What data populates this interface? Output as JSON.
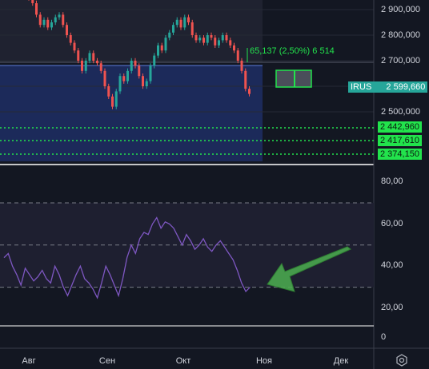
{
  "instrument": {
    "ticker": "IRUS",
    "last_price": "2 599,660"
  },
  "measure": {
    "label": "65,137 (2,50%) 6 514"
  },
  "price_axis": {
    "labels": [
      "2 900,000",
      "2 800,000",
      "2 700,000",
      "2 500,000"
    ],
    "levels": [
      "2 442,960",
      "2 417,610",
      "2 374,150"
    ]
  },
  "rsi_axis": {
    "labels": [
      "80,00",
      "60,00",
      "40,00",
      "20,00",
      "0"
    ]
  },
  "time_axis": {
    "labels": [
      "Авг",
      "Сен",
      "Окт",
      "Ноя",
      "Дек"
    ]
  },
  "colors": {
    "background": "#131722",
    "up": "#26a69a",
    "down": "#ef5350",
    "rsi_line": "#7e57c2",
    "level": "#22e34c",
    "arrow": "#4caf50",
    "box_fill": "#1c2a5a"
  },
  "icons": {
    "settings": "gear-icon",
    "arrow": "arrow-icon"
  },
  "chart_data": {
    "type": "line",
    "price_candles_approx": [
      {
        "o": 2955,
        "c": 2945
      },
      {
        "o": 2945,
        "c": 2925
      },
      {
        "o": 2925,
        "c": 2880
      },
      {
        "o": 2880,
        "c": 2840
      },
      {
        "o": 2840,
        "c": 2860
      },
      {
        "o": 2860,
        "c": 2830
      },
      {
        "o": 2830,
        "c": 2850
      },
      {
        "o": 2850,
        "c": 2870
      },
      {
        "o": 2870,
        "c": 2880
      },
      {
        "o": 2880,
        "c": 2840
      },
      {
        "o": 2840,
        "c": 2800
      },
      {
        "o": 2800,
        "c": 2770
      },
      {
        "o": 2770,
        "c": 2740
      },
      {
        "o": 2740,
        "c": 2700
      },
      {
        "o": 2700,
        "c": 2660
      },
      {
        "o": 2660,
        "c": 2700
      },
      {
        "o": 2700,
        "c": 2730
      },
      {
        "o": 2730,
        "c": 2700
      },
      {
        "o": 2700,
        "c": 2690
      },
      {
        "o": 2690,
        "c": 2660
      },
      {
        "o": 2660,
        "c": 2600
      },
      {
        "o": 2600,
        "c": 2560
      },
      {
        "o": 2560,
        "c": 2520
      },
      {
        "o": 2520,
        "c": 2580
      },
      {
        "o": 2580,
        "c": 2640
      },
      {
        "o": 2640,
        "c": 2620
      },
      {
        "o": 2620,
        "c": 2660
      },
      {
        "o": 2660,
        "c": 2700
      },
      {
        "o": 2700,
        "c": 2680
      },
      {
        "o": 2680,
        "c": 2640
      },
      {
        "o": 2640,
        "c": 2600
      },
      {
        "o": 2600,
        "c": 2620
      },
      {
        "o": 2620,
        "c": 2680
      },
      {
        "o": 2680,
        "c": 2720
      },
      {
        "o": 2720,
        "c": 2760
      },
      {
        "o": 2760,
        "c": 2740
      },
      {
        "o": 2740,
        "c": 2790
      },
      {
        "o": 2790,
        "c": 2810
      },
      {
        "o": 2810,
        "c": 2840
      },
      {
        "o": 2840,
        "c": 2860
      },
      {
        "o": 2860,
        "c": 2830
      },
      {
        "o": 2830,
        "c": 2870
      },
      {
        "o": 2870,
        "c": 2850
      },
      {
        "o": 2850,
        "c": 2800
      },
      {
        "o": 2800,
        "c": 2780
      },
      {
        "o": 2780,
        "c": 2790
      },
      {
        "o": 2790,
        "c": 2770
      },
      {
        "o": 2770,
        "c": 2800
      },
      {
        "o": 2800,
        "c": 2790
      },
      {
        "o": 2790,
        "c": 2760
      },
      {
        "o": 2760,
        "c": 2780
      },
      {
        "o": 2780,
        "c": 2800
      },
      {
        "o": 2800,
        "c": 2780
      },
      {
        "o": 2780,
        "c": 2760
      },
      {
        "o": 2760,
        "c": 2740
      },
      {
        "o": 2740,
        "c": 2700
      },
      {
        "o": 2700,
        "c": 2660
      },
      {
        "o": 2660,
        "c": 2590
      },
      {
        "o": 2590,
        "c": 2570
      }
    ],
    "rsi_values": [
      44,
      46,
      40,
      36,
      31,
      39,
      36,
      33,
      35,
      38,
      34,
      32,
      40,
      36,
      30,
      26,
      31,
      36,
      40,
      34,
      32,
      29,
      25,
      32,
      40,
      36,
      31,
      26,
      34,
      44,
      50,
      46,
      53,
      56,
      55,
      60,
      63,
      58,
      61,
      60,
      58,
      54,
      50,
      55,
      52,
      48,
      50,
      53,
      49,
      47,
      50,
      52,
      49,
      46,
      43,
      38,
      32,
      28,
      30
    ]
  }
}
